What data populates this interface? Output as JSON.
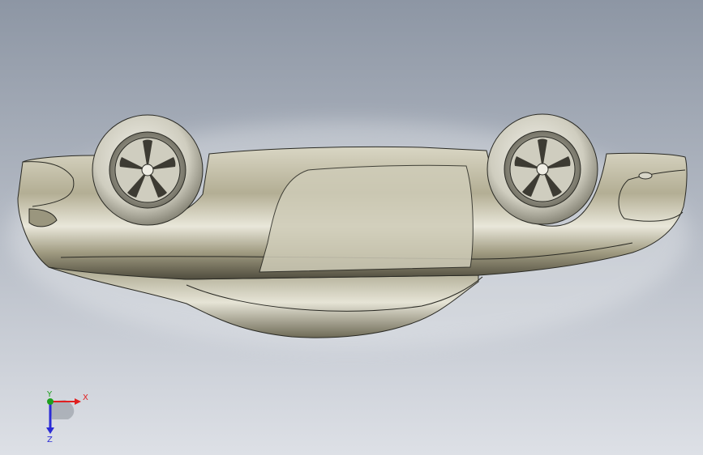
{
  "viewport": {
    "background_top": "#8d96a4",
    "background_bottom": "#dde0e6"
  },
  "model": {
    "body_color": "#b9b59c",
    "body_highlight": "#efede0",
    "body_shadow": "#5f5c4c",
    "tire_color": "#d5d3c6",
    "rim_color": "#7c7a6c",
    "edge_color": "#2a2a24"
  },
  "triad": {
    "x_label": "X",
    "y_label": "Y",
    "z_label": "Z",
    "x_color": "#e02020",
    "y_color": "#1ea01e",
    "z_color": "#2b2bd6"
  }
}
